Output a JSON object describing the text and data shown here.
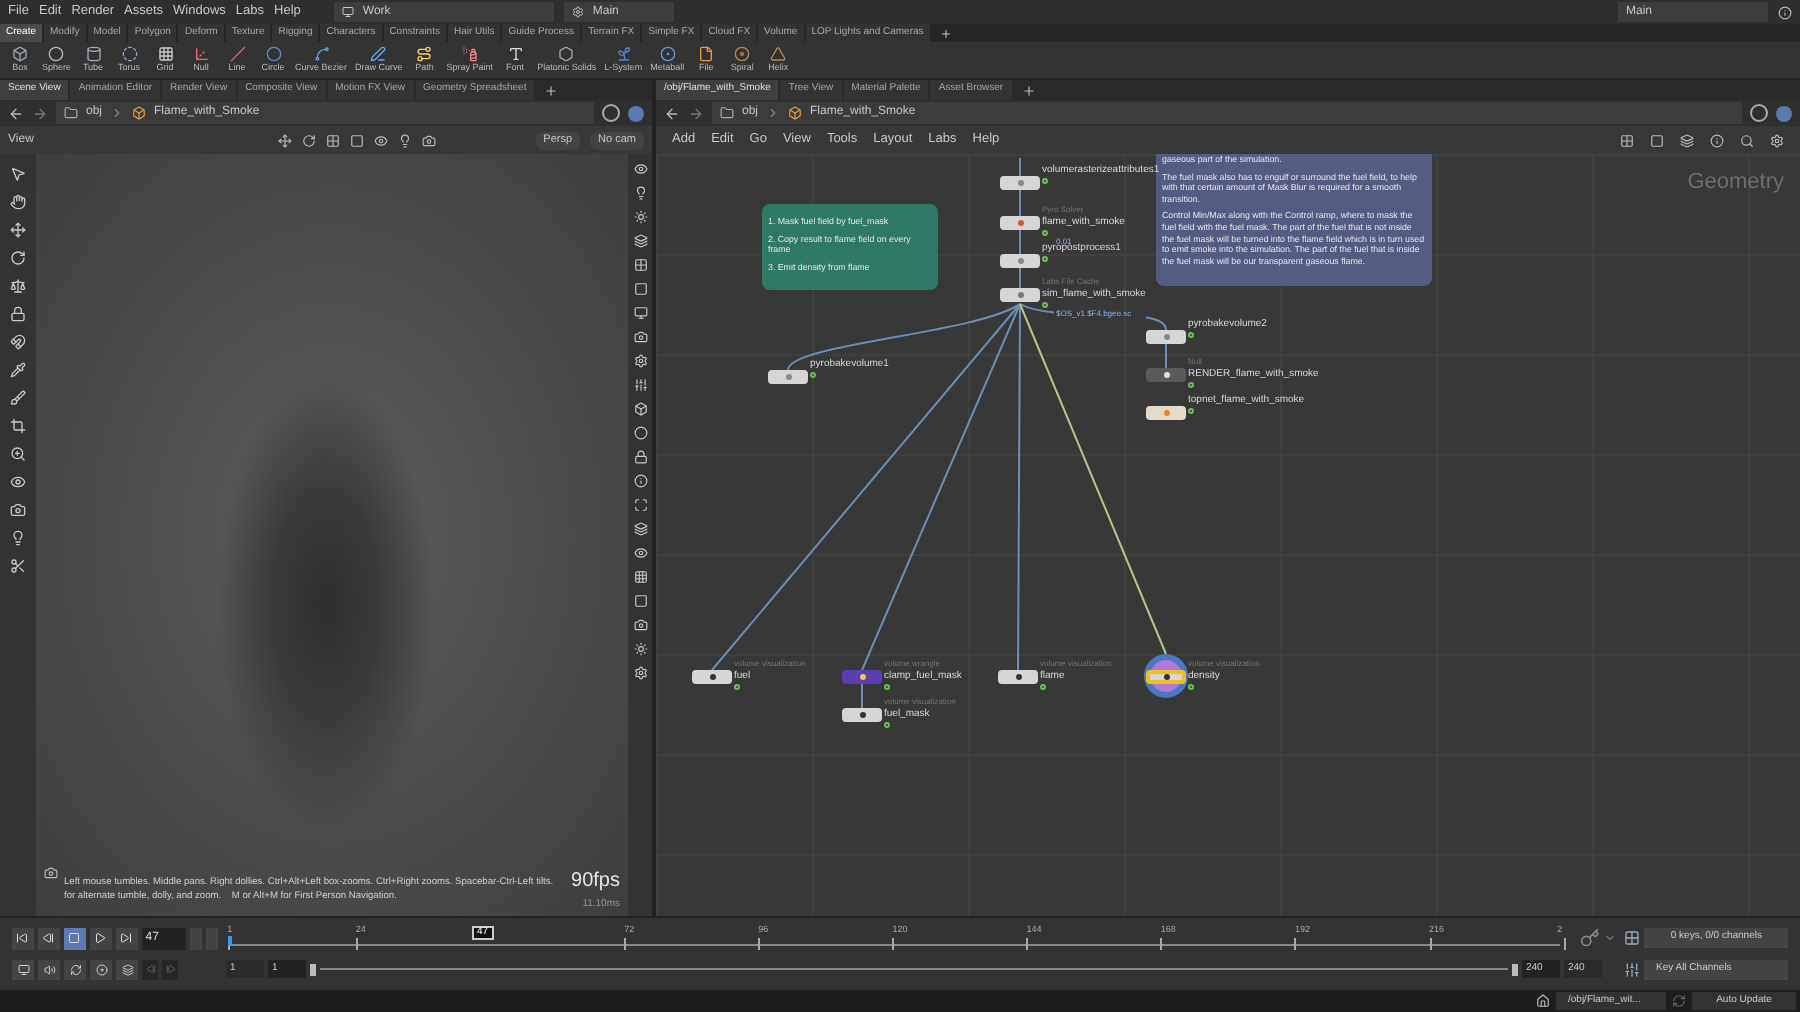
{
  "menubar": {
    "menus": [
      "File",
      "Edit",
      "Render",
      "Assets",
      "Windows",
      "Labs",
      "Help"
    ],
    "desktop": "Work",
    "context": "Main",
    "right_context": "Main"
  },
  "shelf": {
    "tabs": [
      {
        "label": "Create",
        "selected": true
      },
      {
        "label": "Modify",
        "selected": false
      },
      {
        "label": "Model",
        "selected": false
      },
      {
        "label": "Polygon",
        "selected": false
      },
      {
        "label": "Deform",
        "selected": false
      },
      {
        "label": "Texture",
        "selected": false
      },
      {
        "label": "Rigging",
        "selected": false
      },
      {
        "label": "Characters",
        "selected": false
      },
      {
        "label": "Constraints",
        "selected": false
      },
      {
        "label": "Hair Utils",
        "selected": false
      },
      {
        "label": "Guide Process",
        "selected": false
      },
      {
        "label": "Terrain FX",
        "selected": false
      },
      {
        "label": "Simple FX",
        "selected": false
      },
      {
        "label": "Cloud FX",
        "selected": false
      },
      {
        "label": "Volume",
        "selected": false
      },
      {
        "label": "LOP Lights and Cameras",
        "selected": false
      }
    ],
    "tools": [
      "Box",
      "Sphere",
      "Tube",
      "Torus",
      "Grid",
      "Null",
      "Line",
      "Circle",
      "Curve Bezier",
      "Draw Curve",
      "Path",
      "Spray Paint",
      "Font",
      "Platonic Solids",
      "L-System",
      "Metaball",
      "File",
      "Spiral",
      "Helix"
    ]
  },
  "scene_pane": {
    "tabs": [
      {
        "label": "Scene View",
        "selected": true
      },
      {
        "label": "Animation Editor",
        "selected": false
      },
      {
        "label": "Render View",
        "selected": false
      },
      {
        "label": "Composite View",
        "selected": false
      },
      {
        "label": "Motion FX View",
        "selected": false
      },
      {
        "label": "Geometry Spreadsheet",
        "selected": false
      }
    ],
    "path": [
      "obj",
      "Flame_with_Smoke"
    ],
    "view_label": "View",
    "camera_menu": "Persp",
    "cam_menu": "No cam",
    "help_lines": [
      "Left mouse tumbles. Middle pans. Right dollies. Ctrl+Alt+Left box-zooms. Ctrl+Right zooms. Spacebar-Ctrl-Left tilts.",
      "for alternate tumble, dolly, and zoom.    M or Alt+M for First Person Navigation."
    ],
    "fps": "90fps",
    "frame_time": "11.10ms"
  },
  "network_pane": {
    "tabs": [
      {
        "label": "/obj/Flame_with_Smoke",
        "selected": true
      },
      {
        "label": "Tree View",
        "selected": false
      },
      {
        "label": "Material Palette",
        "selected": false
      },
      {
        "label": "Asset Browser",
        "selected": false
      }
    ],
    "path": [
      "obj",
      "Flame_with_Smoke"
    ],
    "menus": [
      "Add",
      "Edit",
      "Go",
      "View",
      "Tools",
      "Layout",
      "Labs",
      "Help"
    ],
    "context_label": "Geometry",
    "sticky_notes": [
      {
        "color": "#2f7a66",
        "paragraphs": [
          "1. Mask fuel field by fuel_mask",
          "2. Copy result to flame field on every frame",
          "3. Emit density from flame"
        ]
      },
      {
        "color": "#545c82",
        "paragraphs": [
          "gaseous part of the simulation.",
          "The fuel mask also has to engulf or surround the fuel field, to help with that certain amount of Mask Blur is required for a smooth transition.",
          "Control Min/Max along with the Control ramp, where to mask the fuel field with the fuel mask. The part of the fuel that is not inside the fuel mask will be turned into the flame field which is in turn used to emit smoke into the simulation. The part of the fuel that is inside the fuel mask will be our transparent gaseous flame."
        ]
      }
    ],
    "nodes": [
      {
        "kind": "plain",
        "name": "volumerasterizeattributes1",
        "selected": false
      },
      {
        "kind": "solver",
        "type": "Pyro Solver",
        "name": "flame_with_smoke",
        "note": "0.01",
        "selected": false
      },
      {
        "kind": "plain",
        "name": "pyropostprocess1",
        "selected": false
      },
      {
        "kind": "cache",
        "type": "Labs File Cache",
        "name": "sim_flame_with_smoke",
        "note": "$OS_v1.$F4.bgeo.sc",
        "selected": false
      },
      {
        "kind": "plain",
        "name": "pyrobakevolume1",
        "selected": false
      },
      {
        "kind": "plain",
        "name": "pyrobakevolume2",
        "selected": false
      },
      {
        "kind": "null",
        "type": "Null",
        "name": "RENDER_flame_with_smoke",
        "selected": false
      },
      {
        "kind": "top",
        "name": "topnet_flame_with_smoke",
        "selected": false
      },
      {
        "kind": "vis",
        "type": "volume visualization",
        "name": "fuel",
        "selected": false
      },
      {
        "kind": "wrangle",
        "type": "volume wrangle",
        "name": "clamp_fuel_mask",
        "selected": false
      },
      {
        "kind": "vis",
        "type": "volume visualization",
        "name": "fuel_mask",
        "selected": false
      },
      {
        "kind": "vis",
        "type": "volume visualization",
        "name": "flame",
        "selected": false
      },
      {
        "kind": "vis",
        "type": "volume visualization",
        "name": "density",
        "selected": true
      }
    ]
  },
  "timeline": {
    "controls": [
      {
        "kind": "first",
        "selected": false
      },
      {
        "kind": "back",
        "selected": false
      },
      {
        "kind": "stop",
        "selected": true
      },
      {
        "kind": "play",
        "selected": false
      },
      {
        "kind": "last",
        "selected": false
      }
    ],
    "frame": "47",
    "ticks": [
      "1",
      "24",
      "72",
      "96",
      "120",
      "144",
      "168",
      "192",
      "216",
      "2"
    ],
    "playhead": "47",
    "level": 0.19,
    "range_start": "1",
    "range_start2": "1",
    "range_end": "240",
    "range_end2": "240",
    "keys": "0 keys, 0/0 channels",
    "key_mode": "Key All Channels"
  },
  "status_bar": {
    "path": "/obj/Flame_wit...",
    "update": "Auto Update"
  }
}
